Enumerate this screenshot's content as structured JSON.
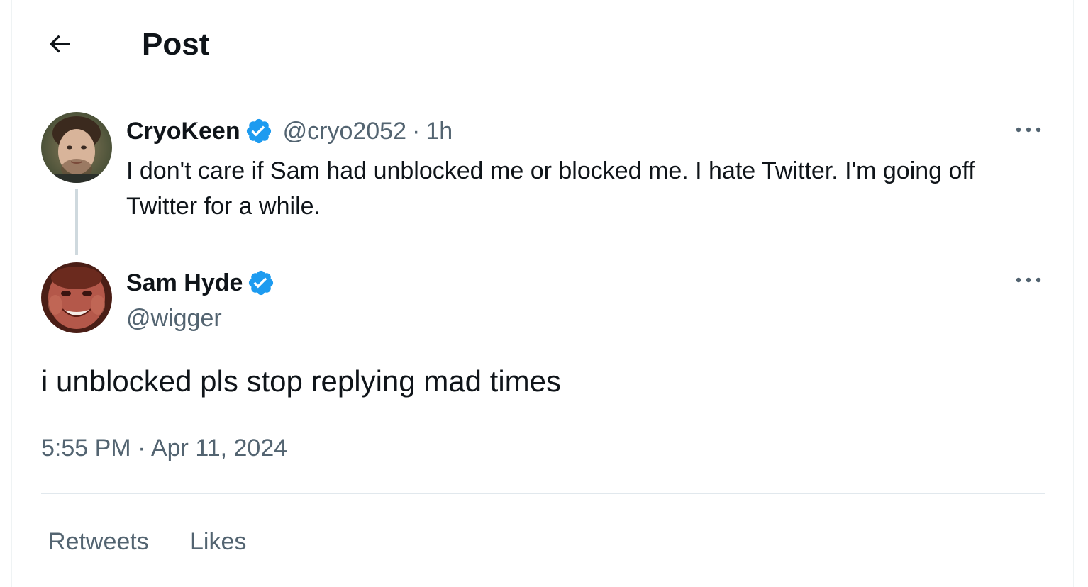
{
  "header": {
    "title": "Post"
  },
  "parent_post": {
    "display_name": "CryoKeen",
    "handle": "@cryo2052",
    "separator": "·",
    "time": "1h",
    "text": "I don't care if Sam had unblocked me or blocked me. I hate Twitter. I'm going off Twitter for a while.",
    "verified_icon": "verified-badge-icon",
    "more_icon": "more-options-icon"
  },
  "main_post": {
    "display_name": "Sam Hyde",
    "handle": "@wigger",
    "text": "i unblocked pls stop replying mad times",
    "timestamp": "5:55 PM · Apr 11, 2024",
    "verified_icon": "verified-badge-icon",
    "more_icon": "more-options-icon"
  },
  "tabs": [
    {
      "label": "Retweets"
    },
    {
      "label": "Likes"
    }
  ],
  "colors": {
    "text_primary": "#0f1419",
    "text_secondary": "#536471",
    "verified_blue": "#1d9bf0",
    "thread_line": "#cfd9de"
  }
}
